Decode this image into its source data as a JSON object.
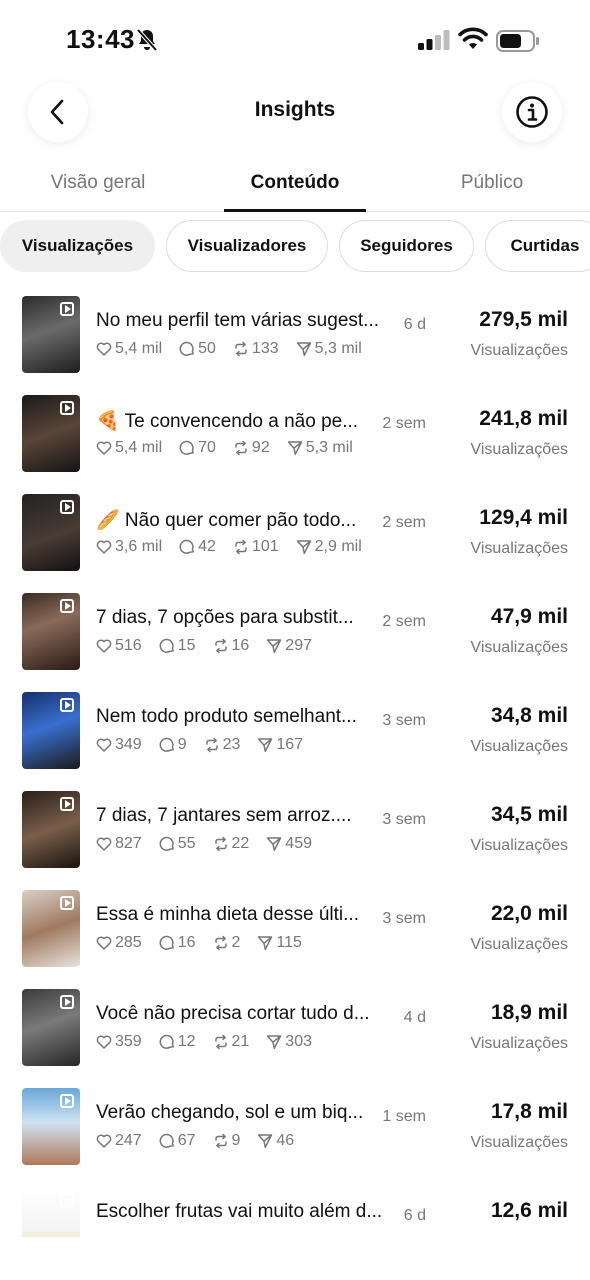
{
  "status_bar": {
    "time": "13:43"
  },
  "header": {
    "title": "Insights"
  },
  "tabs": [
    {
      "label": "Visão geral"
    },
    {
      "label": "Conteúdo"
    },
    {
      "label": "Público"
    }
  ],
  "chips": [
    {
      "label": "Visualizações"
    },
    {
      "label": "Visualizadores"
    },
    {
      "label": "Seguidores"
    },
    {
      "label": "Curtidas"
    }
  ],
  "items": [
    {
      "title": "No meu perfil tem várias sugest...",
      "age": "6 d",
      "likes": "5,4 mil",
      "comments": "50",
      "reposts": "133",
      "shares": "5,3 mil",
      "value": "279,5 mil",
      "label": "Visualizações"
    },
    {
      "title": "🍕 Te convencendo a não pe...",
      "age": "2 sem",
      "likes": "5,4 mil",
      "comments": "70",
      "reposts": "92",
      "shares": "5,3 mil",
      "value": "241,8 mil",
      "label": "Visualizações"
    },
    {
      "title": "🥖 Não quer comer pão todo...",
      "age": "2 sem",
      "likes": "3,6 mil",
      "comments": "42",
      "reposts": "101",
      "shares": "2,9 mil",
      "value": "129,4 mil",
      "label": "Visualizações"
    },
    {
      "title": "7 dias, 7 opções para substit...",
      "age": "2 sem",
      "likes": "516",
      "comments": "15",
      "reposts": "16",
      "shares": "297",
      "value": "47,9 mil",
      "label": "Visualizações"
    },
    {
      "title": "Nem todo produto semelhant...",
      "age": "3 sem",
      "likes": "349",
      "comments": "9",
      "reposts": "23",
      "shares": "167",
      "value": "34,8 mil",
      "label": "Visualizações"
    },
    {
      "title": "7 dias, 7 jantares sem arroz....",
      "age": "3 sem",
      "likes": "827",
      "comments": "55",
      "reposts": "22",
      "shares": "459",
      "value": "34,5 mil",
      "label": "Visualizações"
    },
    {
      "title": "Essa é minha dieta desse últi...",
      "age": "3 sem",
      "likes": "285",
      "comments": "16",
      "reposts": "2",
      "shares": "115",
      "value": "22,0 mil",
      "label": "Visualizações"
    },
    {
      "title": "Você não precisa cortar tudo d...",
      "age": "4 d",
      "likes": "359",
      "comments": "12",
      "reposts": "21",
      "shares": "303",
      "value": "18,9 mil",
      "label": "Visualizações"
    },
    {
      "title": "Verão chegando, sol e um biq...",
      "age": "1 sem",
      "likes": "247",
      "comments": "67",
      "reposts": "9",
      "shares": "46",
      "value": "17,8 mil",
      "label": "Visualizações"
    },
    {
      "title": "Escolher frutas vai muito além d...",
      "age": "6 d",
      "likes": "",
      "comments": "",
      "reposts": "",
      "shares": "",
      "value": "12,6 mil",
      "label": ""
    }
  ]
}
